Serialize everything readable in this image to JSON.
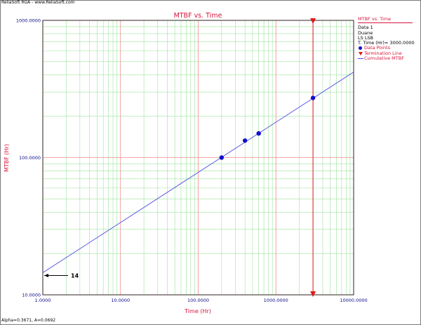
{
  "window": {
    "top_label": "ReliaSoft RGA - www.ReliaSoft.com",
    "bottom_label": "Alpha=0.3671, A=0.0692"
  },
  "legend": {
    "title": "MTBF vs. Time",
    "lines": [
      "Data 1",
      "Duane",
      "LS LSB",
      "T. Time (Hr)= 3000.0000"
    ],
    "items": [
      {
        "label": "Data Points",
        "symbol": "dot-icon"
      },
      {
        "label": "Termination Line",
        "symbol": "triangle-down-icon"
      },
      {
        "label": "Cumulative MTBF",
        "symbol": "line-icon"
      }
    ]
  },
  "colors": {
    "title": "#d9143a",
    "axis_label": "#d9143a",
    "tick_label": "#0a0a8a",
    "data": "#1010cc",
    "fit_line": "#4a4adf",
    "termination": "#e01818",
    "major_grid": "#ef8e8e",
    "minor_grid": "#9ee39e",
    "annotation": "#000000"
  },
  "chart_data": {
    "type": "scatter",
    "title": "MTBF vs. Time",
    "xlabel": "Time (Hr)",
    "ylabel": "MTBF (Hr)",
    "xscale": "log",
    "yscale": "log",
    "xlim": [
      1,
      10000
    ],
    "ylim": [
      10,
      1000
    ],
    "x_ticks": [
      1,
      10,
      100,
      1000,
      10000
    ],
    "x_tick_labels": [
      "1.0000",
      "10.0000",
      "100.0000",
      "1000.0000",
      "10000.0000"
    ],
    "y_ticks": [
      10,
      100,
      1000
    ],
    "y_tick_labels": [
      "10.0000",
      "100.0000",
      "1000.0000"
    ],
    "grid": true,
    "series": [
      {
        "name": "Data Points",
        "kind": "points",
        "x": [
          200,
          400,
          600,
          3000
        ],
        "y": [
          100,
          133,
          150,
          272
        ]
      },
      {
        "name": "Cumulative MTBF",
        "kind": "line",
        "x": [
          1,
          10000
        ],
        "y": [
          14.5,
          420
        ]
      },
      {
        "name": "Termination Line",
        "kind": "vline",
        "x": 3000
      }
    ],
    "annotations": [
      {
        "text": "14",
        "x": 1,
        "y": 14.5
      }
    ]
  }
}
